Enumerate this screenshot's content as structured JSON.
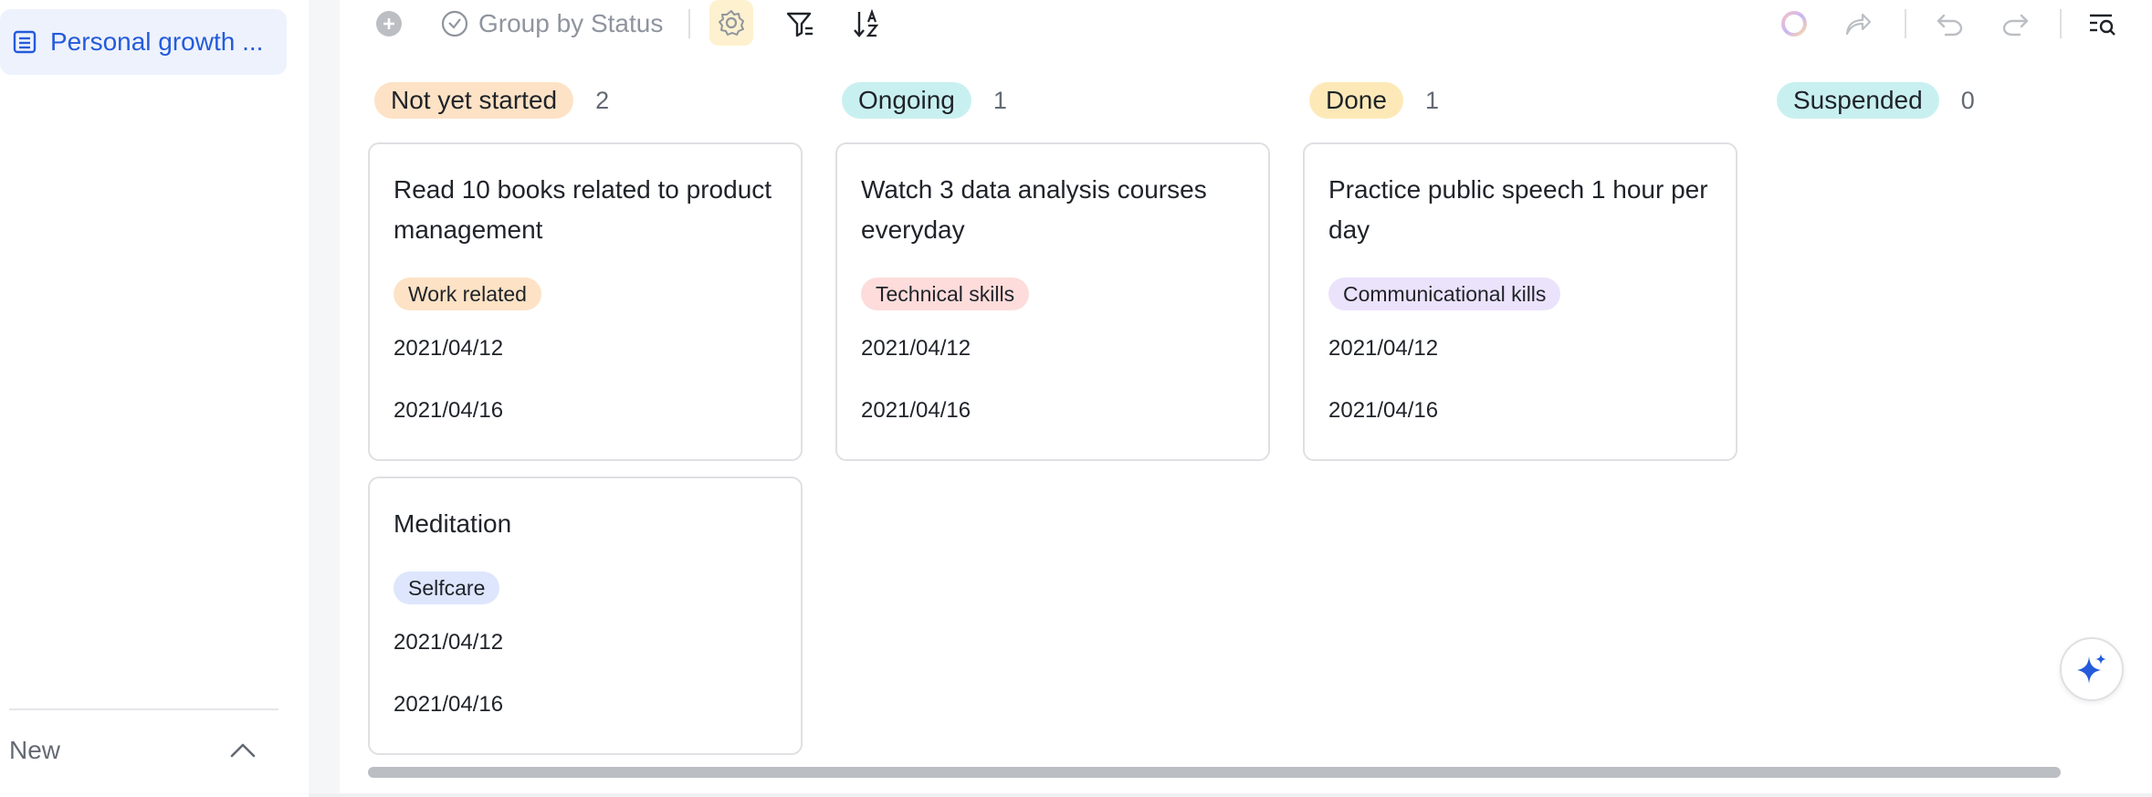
{
  "sidebar": {
    "active_item": "Personal growth ...",
    "new_label": "New"
  },
  "toolbar": {
    "group_label": "Group by Status"
  },
  "columns": [
    {
      "status": "Not yet started",
      "count": "2",
      "pill_color": "#fde2c5"
    },
    {
      "status": "Ongoing",
      "count": "1",
      "pill_color": "#c9f0f0"
    },
    {
      "status": "Done",
      "count": "1",
      "pill_color": "#fde9b8"
    },
    {
      "status": "Suspended",
      "count": "0",
      "pill_color": "#c9f0f0"
    }
  ],
  "cards": [
    {
      "title": "Read 10 books related to product management",
      "tag": "Work related",
      "tag_color": "#fde2c5",
      "start": "2021/04/12",
      "end": "2021/04/16"
    },
    {
      "title": "Watch 3 data analysis courses everyday",
      "tag": "Technical skills",
      "tag_color": "#fddcdb",
      "start": "2021/04/12",
      "end": "2021/04/16"
    },
    {
      "title": "Practice public speech 1 hour per day",
      "tag": "Communicational kills",
      "tag_color": "#ebe2fb",
      "start": "2021/04/12",
      "end": "2021/04/16"
    },
    {
      "title": "Meditation",
      "tag": "Selfcare",
      "tag_color": "#dde6fc",
      "start": "2021/04/12",
      "end": "2021/04/16"
    }
  ],
  "icons": {
    "table": "table-icon",
    "add": "plus-circle-icon",
    "group": "check-circle-icon",
    "settings": "gear-icon",
    "filter": "filter-icon",
    "sort": "sort-icon",
    "loading": "loading-ring-icon",
    "share": "share-icon",
    "undo": "undo-icon",
    "redo": "redo-icon",
    "search": "search-list-icon",
    "ai": "sparkle-icon",
    "collapse": "chevron-up-icon"
  },
  "colors": {
    "accent": "#245bdb"
  }
}
